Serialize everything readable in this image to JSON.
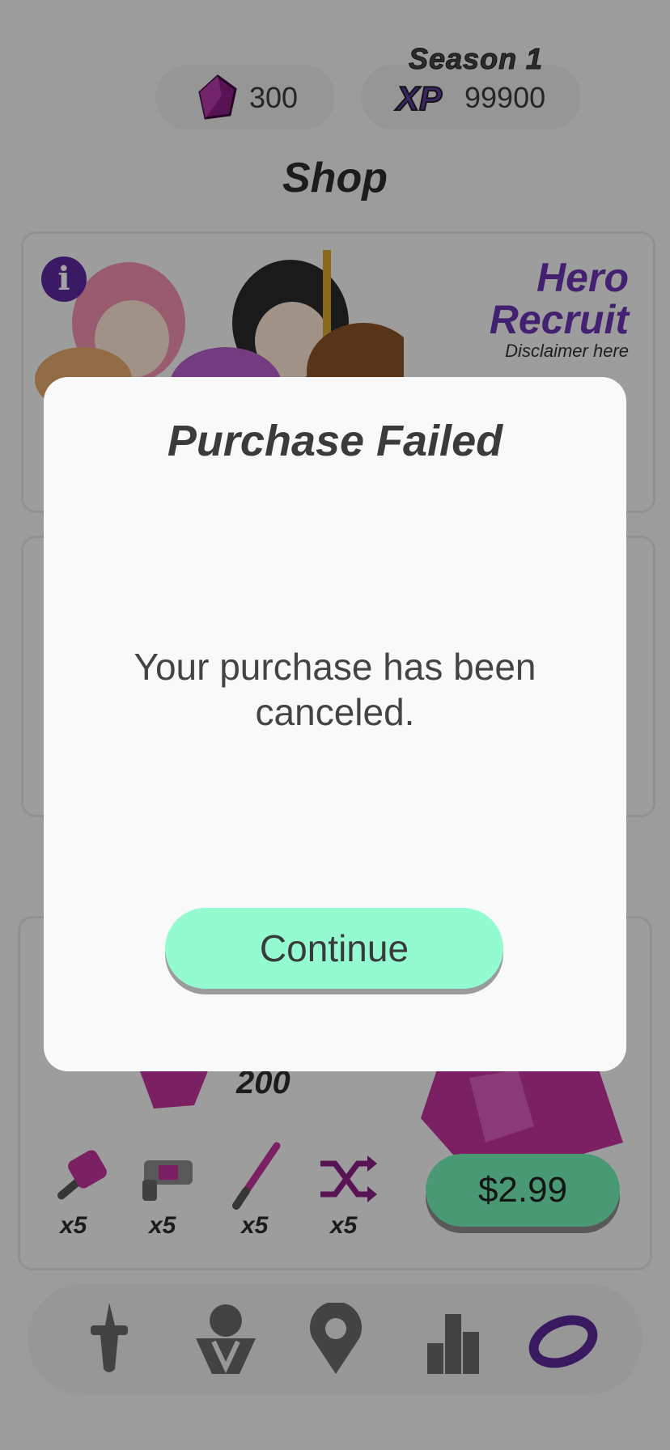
{
  "header": {
    "gems_value": "300",
    "season_label": "Season 1",
    "xp_label": "XP",
    "xp_value": "99900",
    "title": "Shop"
  },
  "hero_card": {
    "title_line1": "Hero",
    "title_line2": "Recruit",
    "disclaimer": "Disclaimer here",
    "info_label": "i"
  },
  "bundle_card": {
    "gem_amount": "200",
    "items": [
      {
        "icon": "hammer-icon",
        "qty": "x5"
      },
      {
        "icon": "blaster-icon",
        "qty": "x5"
      },
      {
        "icon": "lightsaber-icon",
        "qty": "x5"
      },
      {
        "icon": "shuffle-icon",
        "qty": "x5"
      }
    ],
    "price": "$2.99"
  },
  "nav": {
    "items": [
      "sword-icon",
      "guild-icon",
      "map-pin-icon",
      "leaderboard-icon",
      "currency-icon"
    ],
    "active_index": 4
  },
  "modal": {
    "title": "Purchase Failed",
    "message": "Your purchase has been canceled.",
    "button": "Continue"
  },
  "colors": {
    "accent_purple": "#6a34b0",
    "continue_green": "#94fbd1",
    "price_green": "#73f0b8",
    "gem_magenta": "#c0339b"
  }
}
